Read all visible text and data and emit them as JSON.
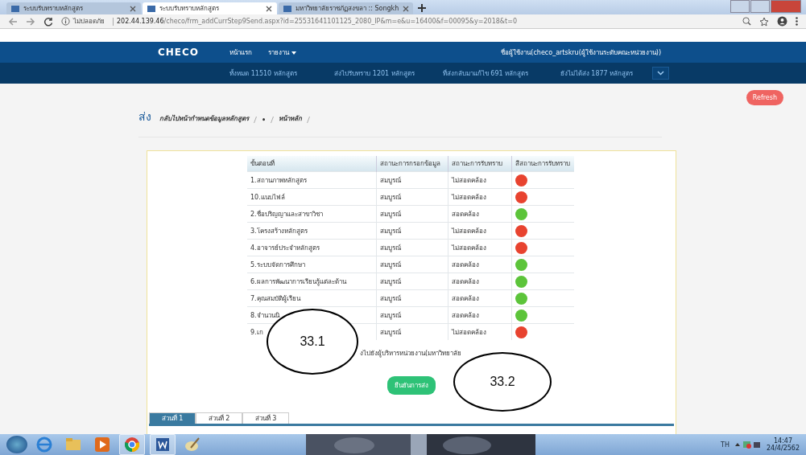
{
  "browser": {
    "tabs": [
      {
        "title": "ระบบรับทราบหลักสูตร",
        "selected": false
      },
      {
        "title": "ระบบรับทราบหลักสูตร",
        "selected": true
      },
      {
        "title": "มหาวิทยาลัยราชภัฏสงขลา :: Songkh",
        "selected": false
      }
    ],
    "security": "ไม่ปลอดภัย",
    "url_host": "202.44.139.46",
    "url_path": "/checo/frm_addCurrStep9Send.aspx?id=25531641101125_2080_IP&m=e&u=16400&f=00095&y=2018&t=0"
  },
  "navbar": {
    "brand": "CHECO",
    "links": [
      "หน้าแรก",
      "รายงาน"
    ],
    "user": "ชื่อผู้ใช้งาน(checo_artskru(ผู้ใช้งานระดับคณะหน่วยงาน))"
  },
  "stats": [
    "ทั้งหมด 11510 หลักสูตร",
    "ส่งไปรับทราบ 1201 หลักสูตร",
    "ที่ส่งกลับมาแก้ไข 691 หลักสูตร",
    "ยังไม่ได้ส่ง 1877 หลักสูตร"
  ],
  "page": {
    "title": "ส่ง",
    "breadcrumb": [
      "กลับไปหน้ากำหนดข้อมูลหลักสูตร",
      "•",
      "หน้าหลัก"
    ],
    "refresh": "Refresh"
  },
  "table": {
    "columns": [
      "ขั้นตอนที่",
      "สถานะการกรอกข้อมูล",
      "สถานะการรับทราบ",
      "สีสถานะการรับทราบ"
    ],
    "rows": [
      {
        "step": "1.สถานภาพหลักสูตร",
        "entry": "สมบูรณ์",
        "ack": "ไม่สอดคล้อง",
        "color": "#e8432f"
      },
      {
        "step": "10.แนบไฟล์",
        "entry": "สมบูรณ์",
        "ack": "ไม่สอดคล้อง",
        "color": "#e8432f"
      },
      {
        "step": "2.ชื่อปริญญาและสาขาวิชา",
        "entry": "สมบูรณ์",
        "ack": "สอดคล้อง",
        "color": "#5cc43a"
      },
      {
        "step": "3.โครงสร้างหลักสูตร",
        "entry": "สมบูรณ์",
        "ack": "ไม่สอดคล้อง",
        "color": "#e8432f"
      },
      {
        "step": "4.อาจารย์ประจำหลักสูตร",
        "entry": "สมบูรณ์",
        "ack": "ไม่สอดคล้อง",
        "color": "#e8432f"
      },
      {
        "step": "5.ระบบจัดการศึกษา",
        "entry": "สมบูรณ์",
        "ack": "สอดคล้อง",
        "color": "#5cc43a"
      },
      {
        "step": "6.ผลการพัฒนาการเรียนรู้แต่ละด้าน",
        "entry": "สมบูรณ์",
        "ack": "สอดคล้อง",
        "color": "#5cc43a"
      },
      {
        "step": "7.คุณสมบัติผู้เรียน",
        "entry": "สมบูรณ์",
        "ack": "สอดคล้อง",
        "color": "#5cc43a"
      },
      {
        "step": "8.จำนวนนิ",
        "entry": "สมบูรณ์",
        "ack": "สอดคล้อง",
        "color": "#5cc43a"
      },
      {
        "step": "9.เก",
        "entry": "สมบูรณ์",
        "ack": "ไม่สอดคล้อง",
        "color": "#e8432f"
      }
    ]
  },
  "message": "งไปยังผู้บริหารหน่วยงาน(มหาวิทยาลัย",
  "confirm": "ยืนยันการส่ง",
  "sections": [
    {
      "label": "ส่วนที่ 1",
      "selected": true
    },
    {
      "label": "ส่วนที่ 2",
      "selected": false
    },
    {
      "label": "ส่วนที่ 3",
      "selected": false
    }
  ],
  "annotations": [
    "33.1",
    "33.2"
  ],
  "taskbar": {
    "language": "TH",
    "time": "14:47",
    "date": "24/4/2562"
  }
}
